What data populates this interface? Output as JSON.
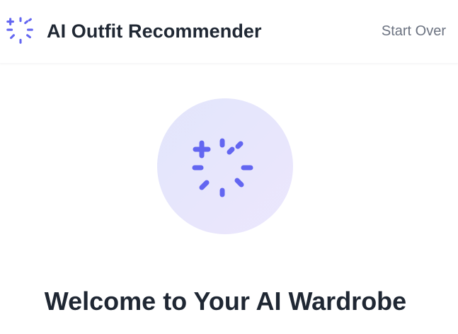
{
  "header": {
    "title": "AI Outfit Recommender",
    "logo_icon": "sparkle-loader-icon",
    "start_over_label": "Start Over"
  },
  "hero": {
    "icon": "sparkle-loader-icon",
    "heading": "Welcome to Your AI Wardrobe"
  },
  "colors": {
    "accent": "#6366f1",
    "text_dark": "#1f2733",
    "text_muted": "#6b7280",
    "circle_start": "#e2e5fb",
    "circle_end": "#ece7fd"
  }
}
